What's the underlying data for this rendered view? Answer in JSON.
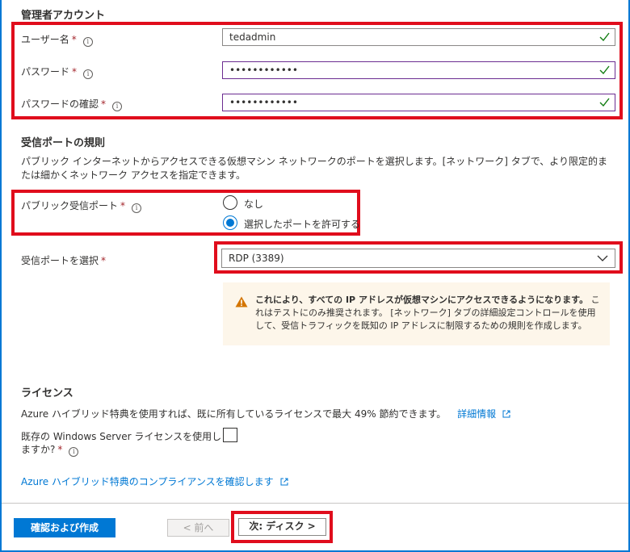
{
  "admin": {
    "section_title": "管理者アカウント",
    "username_label": "ユーザー名",
    "username_value": "tedadmin",
    "password_label": "パスワード",
    "password_value": "••••••••••••",
    "confirm_label": "パスワードの確認",
    "confirm_value": "••••••••••••",
    "required_mark": "*",
    "info_glyph": "i"
  },
  "inbound": {
    "section_title": "受信ポートの規則",
    "description": "パブリック インターネットからアクセスできる仮想マシン ネットワークのポートを選択します。[ネットワーク] タブで、より限定的または細かくネットワーク アクセスを指定できます。",
    "public_ports_label": "パブリック受信ポート",
    "options": [
      "なし",
      "選択したポートを許可する"
    ],
    "selected_option": 1,
    "select_ports_label": "受信ポートを選択",
    "selected_port": "RDP (3389)",
    "warning_bold": "これにより、すべての IP アドレスが仮想マシンにアクセスできるようになります。",
    "warning_rest": " これはテストにのみ推奨されます。 [ネットワーク] タブの詳細設定コントロールを使用して、受信トラフィックを既知の IP アドレスに制限するための規則を作成します。"
  },
  "license": {
    "section_title": "ライセンス",
    "description": "Azure ハイブリッド特典を使用すれば、既に所有しているライセンスで最大 49% 節約できます。",
    "learn_more": "詳細情報",
    "existing_label_line1": "既存の Windows Server ライセンスを使用し",
    "existing_label_line2": "ますか?",
    "compliance_link": "Azure ハイブリッド特典のコンプライアンスを確認します"
  },
  "footer": {
    "review_create": "確認および作成",
    "previous": "< 前へ",
    "next": "次: ディスク >"
  },
  "colors": {
    "accent": "#0078d4",
    "highlight": "#e00d1c",
    "success": "#107c10",
    "warning": "#d47500"
  }
}
